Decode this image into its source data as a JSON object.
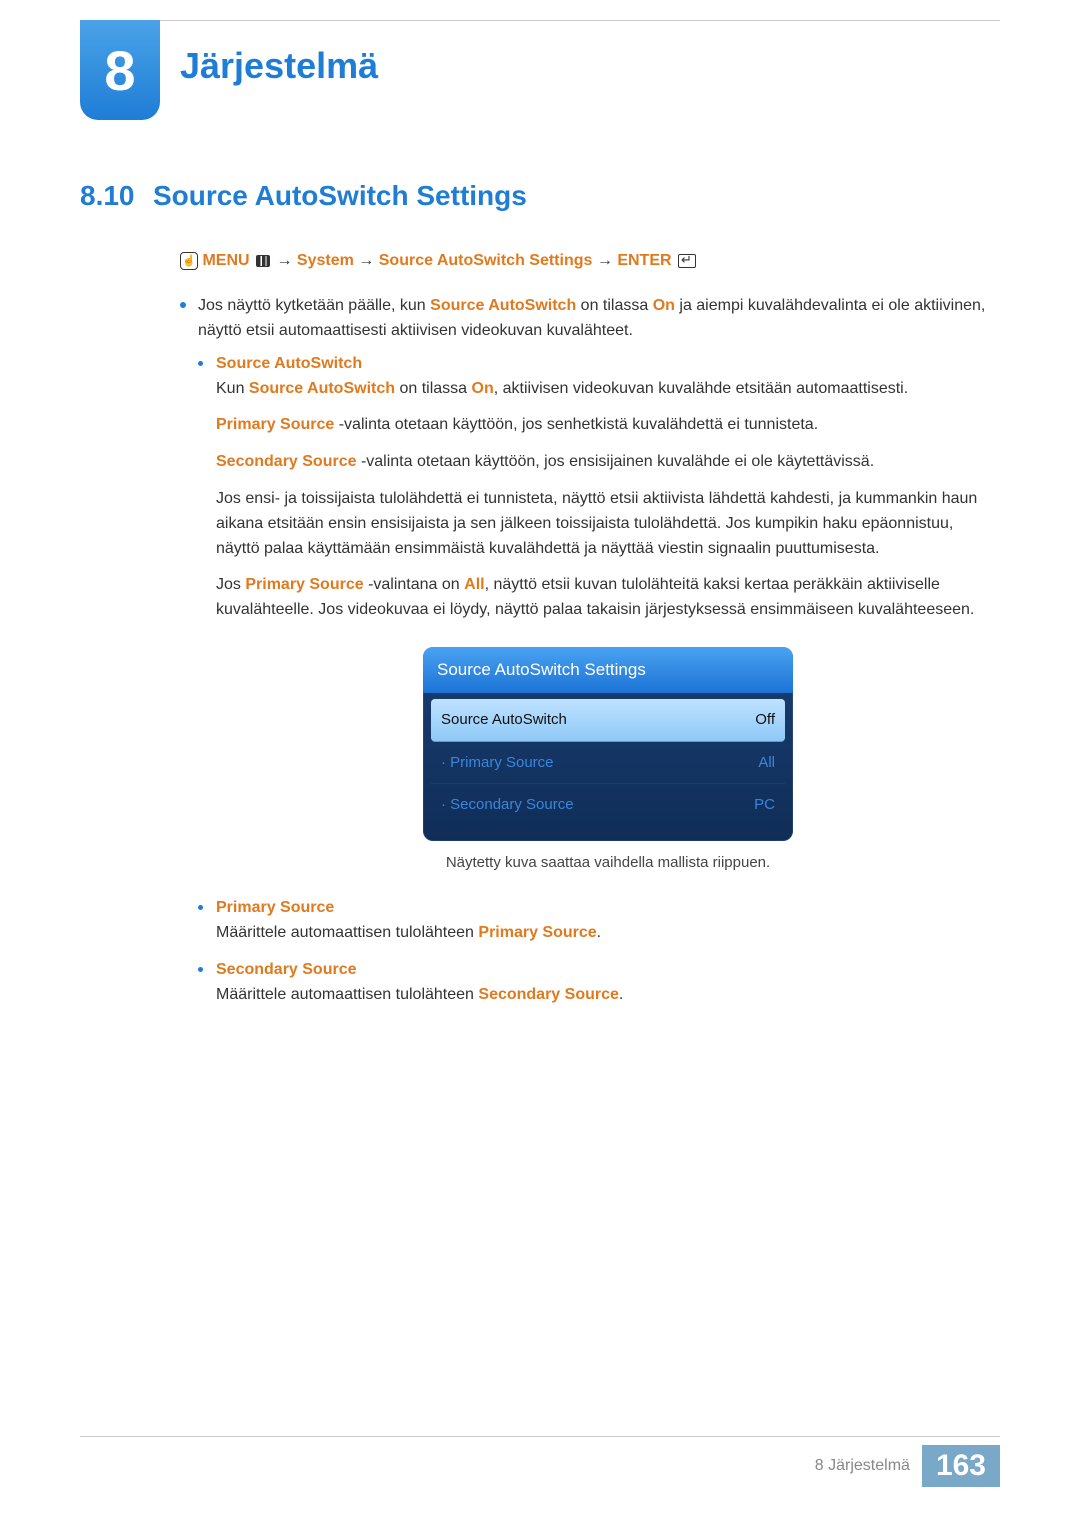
{
  "chapter": {
    "number": "8",
    "title": "Järjestelmä"
  },
  "section": {
    "number": "8.10",
    "title": "Source AutoSwitch Settings"
  },
  "nav_path": {
    "menu": "MENU",
    "arrow": " → ",
    "system": "System",
    "setting": "Source AutoSwitch Settings",
    "enter": "ENTER"
  },
  "intro": {
    "p1a": "Jos näyttö kytketään päälle, kun ",
    "p1b": "Source AutoSwitch",
    "p1c": " on tilassa ",
    "p1d": "On",
    "p1e": " ja aiempi kuvalähdevalinta ei ole aktiivinen, näyttö etsii automaattisesti aktiivisen videokuvan kuvalähteet."
  },
  "source_auto": {
    "heading": "Source AutoSwitch",
    "p1a": "Kun ",
    "p1b": "Source AutoSwitch",
    "p1c": " on tilassa ",
    "p1d": "On",
    "p1e": ", aktiivisen videokuvan kuvalähde etsitään automaattisesti.",
    "p2a": "Primary Source",
    "p2b": " -valinta otetaan käyttöön, jos senhetkistä kuvalähdettä ei tunnisteta.",
    "p3a": "Secondary Source",
    "p3b": " -valinta otetaan käyttöön, jos ensisijainen kuvalähde ei ole käytettävissä.",
    "p4": "Jos ensi- ja toissijaista tulolähdettä ei tunnisteta, näyttö etsii aktiivista lähdettä kahdesti, ja kummankin haun aikana etsitään ensin ensisijaista ja sen jälkeen toissijaista tulolähdettä. Jos kumpikin haku epäonnistuu, näyttö palaa käyttämään ensimmäistä kuvalähdettä ja näyttää viestin signaalin puuttumisesta.",
    "p5a": "Jos ",
    "p5b": "Primary Source",
    "p5c": " -valintana on ",
    "p5d": "All",
    "p5e": ", näyttö etsii kuvan tulolähteitä kaksi kertaa peräkkäin aktiiviselle kuvalähteelle. Jos videokuvaa ei löydy, näyttö palaa takaisin järjestyksessä ensimmäiseen kuvalähteeseen."
  },
  "osd": {
    "title": "Source AutoSwitch Settings",
    "rows": [
      {
        "label": "Source AutoSwitch",
        "value": "Off"
      },
      {
        "label": "· Primary Source",
        "value": "All"
      },
      {
        "label": "· Secondary Source",
        "value": "PC"
      }
    ],
    "caption": "Näytetty kuva saattaa vaihdella mallista riippuen."
  },
  "primary": {
    "heading": "Primary Source",
    "p_a": "Määrittele automaattisen tulolähteen ",
    "p_b": "Primary Source",
    "p_c": "."
  },
  "secondary": {
    "heading": "Secondary Source",
    "p_a": "Määrittele automaattisen tulolähteen ",
    "p_b": "Secondary Source",
    "p_c": "."
  },
  "footer": {
    "label": "8 Järjestelmä",
    "page": "163"
  }
}
